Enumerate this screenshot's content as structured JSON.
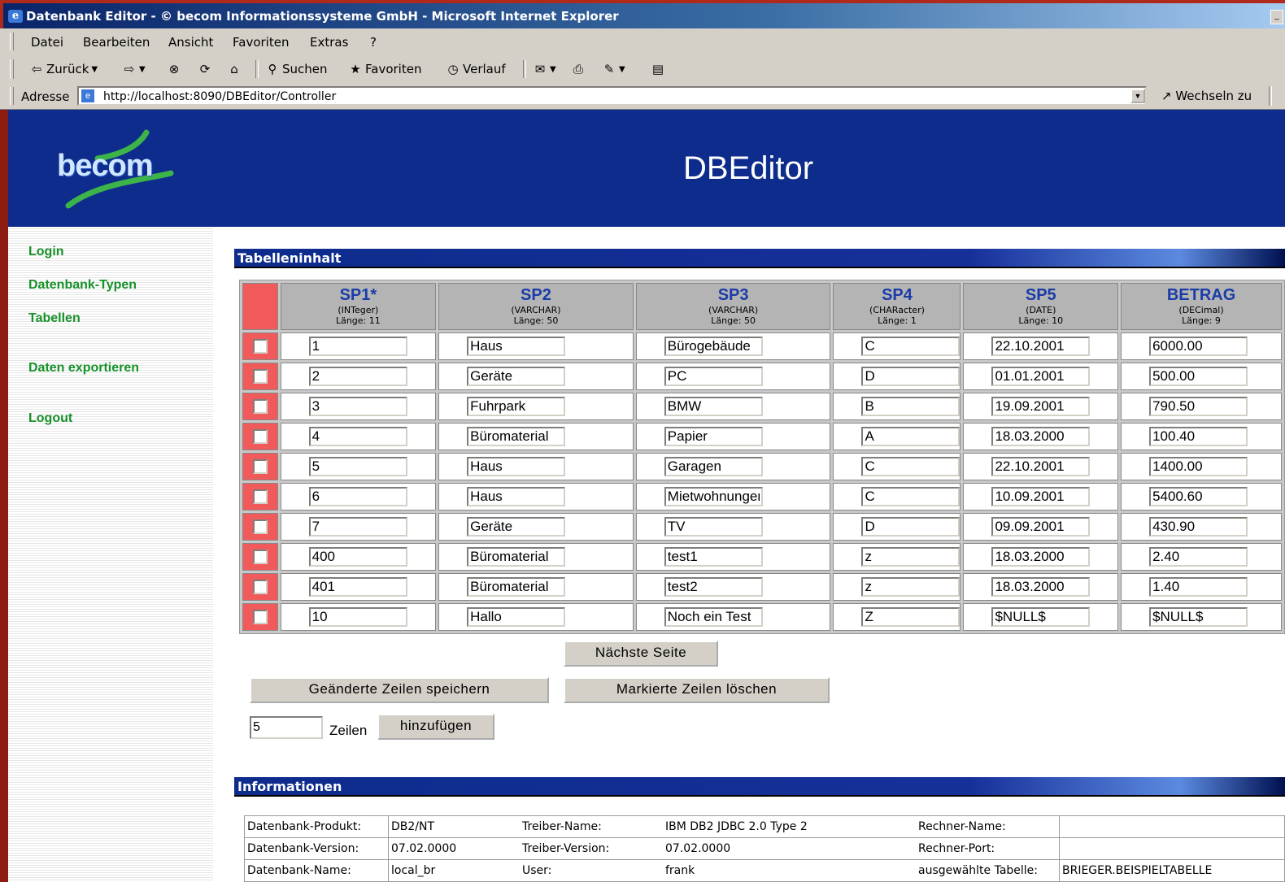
{
  "window": {
    "title": "Datenbank Editor - © becom Informationssysteme GmbH - Microsoft Internet Explorer"
  },
  "menu": [
    "Datei",
    "Bearbeiten",
    "Ansicht",
    "Favoriten",
    "Extras",
    "?"
  ],
  "toolbar": {
    "back": "Zurück",
    "search": "Suchen",
    "favorites": "Favoriten",
    "history": "Verlauf"
  },
  "address": {
    "label": "Adresse",
    "url": "http://localhost:8090/DBEditor/Controller",
    "go": "Wechseln zu"
  },
  "header": {
    "logo": "becom",
    "title": "DBEditor"
  },
  "nav": [
    "Login",
    "Datenbank-Typen",
    "Tabellen",
    "Daten exportieren",
    "Logout"
  ],
  "section_content": "Tabelleninhalt",
  "section_info": "Informationen",
  "columns": [
    {
      "name": "SP1*",
      "type": "(INTeger)",
      "len": "Länge: 11"
    },
    {
      "name": "SP2",
      "type": "(VARCHAR)",
      "len": "Länge: 50"
    },
    {
      "name": "SP3",
      "type": "(VARCHAR)",
      "len": "Länge: 50"
    },
    {
      "name": "SP4",
      "type": "(CHARacter)",
      "len": "Länge: 1"
    },
    {
      "name": "SP5",
      "type": "(DATE)",
      "len": "Länge: 10"
    },
    {
      "name": "BETRAG",
      "type": "(DECimal)",
      "len": "Länge: 9"
    }
  ],
  "rows": [
    [
      "1",
      "Haus",
      "Bürogebäude",
      "C",
      "22.10.2001",
      "6000.00"
    ],
    [
      "2",
      "Geräte",
      "PC",
      "D",
      "01.01.2001",
      "500.00"
    ],
    [
      "3",
      "Fuhrpark",
      "BMW",
      "B",
      "19.09.2001",
      "790.50"
    ],
    [
      "4",
      "Büromaterial",
      "Papier",
      "A",
      "18.03.2000",
      "100.40"
    ],
    [
      "5",
      "Haus",
      "Garagen",
      "C",
      "22.10.2001",
      "1400.00"
    ],
    [
      "6",
      "Haus",
      "Mietwohnungen",
      "C",
      "10.09.2001",
      "5400.60"
    ],
    [
      "7",
      "Geräte",
      "TV",
      "D",
      "09.09.2001",
      "430.90"
    ],
    [
      "400",
      "Büromaterial",
      "test1",
      "z",
      "18.03.2000",
      "2.40"
    ],
    [
      "401",
      "Büromaterial",
      "test2",
      "z",
      "18.03.2000",
      "1.40"
    ],
    [
      "10",
      "Hallo",
      "Noch ein Test",
      "Z",
      "$NULL$",
      "$NULL$"
    ]
  ],
  "buttons": {
    "next": "Nächste Seite",
    "save": "Geänderte Zeilen speichern",
    "delete": "Markierte Zeilen löschen",
    "add": "hinzufügen"
  },
  "add_rows": {
    "value": "5",
    "label": "Zeilen"
  },
  "info": [
    [
      "Datenbank-Produkt:",
      "DB2/NT",
      "Treiber-Name:",
      "IBM DB2 JDBC 2.0 Type 2",
      "Rechner-Name:",
      ""
    ],
    [
      "Datenbank-Version:",
      "07.02.0000",
      "Treiber-Version:",
      "07.02.0000",
      "Rechner-Port:",
      ""
    ],
    [
      "Datenbank-Name:",
      "local_br",
      "User:",
      "frank",
      "ausgewählte Tabelle:",
      "BRIEGER.BEISPIELTABELLE"
    ]
  ]
}
